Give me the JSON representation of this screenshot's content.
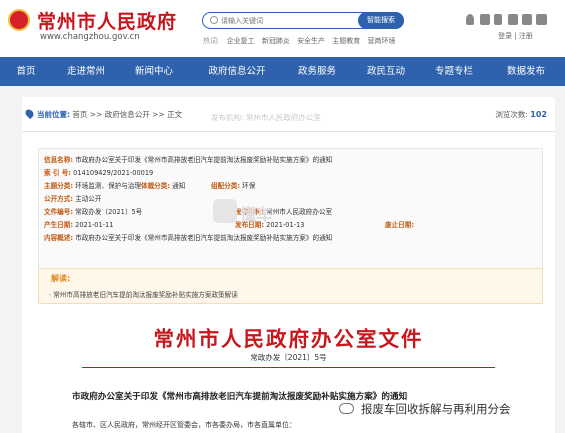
{
  "header": {
    "site_title": "常州市人民政府",
    "site_url": "www.changzhou.gov.cn",
    "search_placeholder": "请输入关键词",
    "search_button": "智能搜索",
    "hot_label": "热词:",
    "hot_words": [
      "企业复工",
      "新冠肺炎",
      "安全生产",
      "主题教育",
      "营商环境"
    ],
    "login_text": "登录 | 注册"
  },
  "nav": {
    "items": [
      "首页",
      "走进常州",
      "新闻中心",
      "政府信息公开",
      "政务服务",
      "政民互动",
      "专题专栏",
      "数据发布"
    ]
  },
  "breadcrumb": {
    "here_label": "当前位置:",
    "path": "首页 >> 政府信息公开 >> 正文",
    "views_label": "浏览次数:",
    "views_count": "102"
  },
  "meta": {
    "info_name_label": "信息名称:",
    "info_name": "市政府办公室关于印发《常州市高排放老旧汽车提前淘汰报废奖励补贴实施方案》的通知",
    "index_label": "索 引 号:",
    "index_no": "014109429/2021-00019",
    "topic_label": "主题分类:",
    "topic": "环境监测、保护与治理",
    "genre_label": "体裁分类:",
    "genre": "通知",
    "org_label": "组配分类:",
    "org": "环保",
    "open_label": "公开方式:",
    "open": "主动公开",
    "issuer_label": "发布机构:",
    "issuer": "常州市人民政府办公室",
    "docno_label": "文件编号:",
    "docno": "常政办发〔2021〕5号",
    "created_label": "产生日期:",
    "created": "2021-01-11",
    "published_label": "发布日期:",
    "published": "2021-01-13",
    "abolish_label": "废止日期:",
    "abolish": "",
    "summary_label": "内容概述:",
    "summary": "市政府办公室关于印发《常州市高排放老旧汽车提前淘汰报废奖励补贴实施方案》的通知"
  },
  "interpretation": {
    "title": "解读:",
    "item": "· 常州市高排放老旧汽车提前淘汰报废奖励补贴实施方案政策解读"
  },
  "document": {
    "title": "常州市人民政府办公室文件",
    "number": "常政办发〔2021〕5号",
    "notice": "市政府办公室关于印发《常州市高排放老旧汽车提前淘汰报废奖励补贴实施方案》的通知",
    "greeting": "各辖市、区人民政府，常州经开区管委会，市各委办局，市各直属单位："
  },
  "watermark": {
    "small_text": "发布机构: 常州市人民政府办公室",
    "big_text": "懂车"
  },
  "wechat": {
    "account": "报废车回收拆解与再利用分会"
  },
  "colors": {
    "brand_red": "#c8161d",
    "nav_blue": "#2f62ad",
    "label_orange": "#c35a13"
  }
}
